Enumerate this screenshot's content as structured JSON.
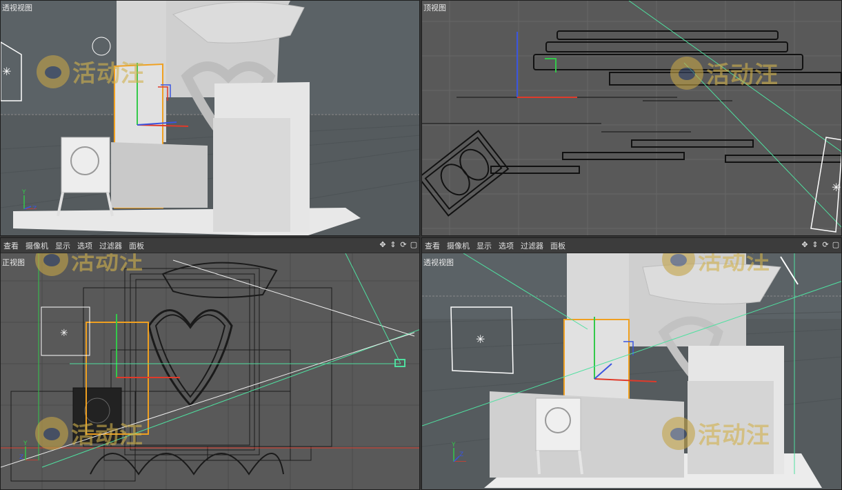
{
  "viewports": {
    "top_left": {
      "label": "透视视图"
    },
    "top_right": {
      "label": "顶视图"
    },
    "bottom_left": {
      "label": "正视图",
      "menu": [
        "查看",
        "摄像机",
        "显示",
        "选项",
        "过滤器",
        "面板"
      ]
    },
    "bottom_right": {
      "label": "透视视图",
      "menu": [
        "查看",
        "摄像机",
        "显示",
        "选项",
        "过滤器",
        "面板"
      ]
    }
  },
  "watermark": {
    "text": "活动汪"
  },
  "axis_labels": {
    "x": "X",
    "y": "Y",
    "z": "Z"
  },
  "colors": {
    "axis_x": "#e03a2a",
    "axis_y": "#33c94a",
    "axis_z": "#3a55e0",
    "selection": "#f0a020",
    "guide": "#4fe0a0"
  },
  "icons": [
    "move-icon",
    "arrows-icon",
    "rotate-icon",
    "maximize-icon"
  ]
}
